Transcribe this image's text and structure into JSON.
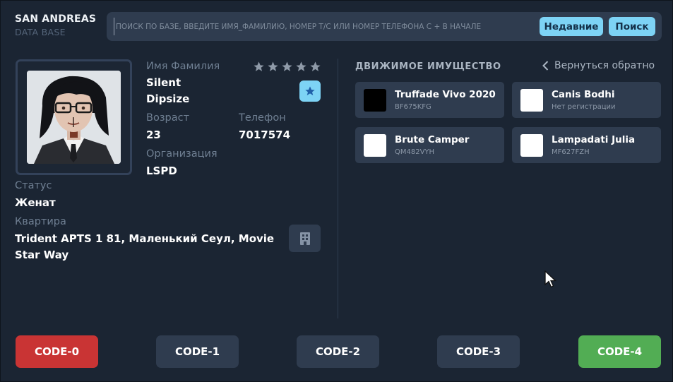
{
  "header": {
    "brand_title": "SAN ANDREAS",
    "brand_subtitle": "DATA BASE",
    "search_placeholder": "ПОИСК ПО БАЗЕ, ВВЕДИТЕ ИМЯ_ФАМИЛИЮ, НОМЕР Т/С ИЛИ НОМЕР ТЕЛЕФОНА С + В НАЧАЛЕ",
    "search_value": "",
    "recent_label": "Недавние",
    "search_label": "Поиск"
  },
  "profile": {
    "name_label": "Имя Фамилия",
    "first_name": "Silent",
    "last_name": "Dipsize",
    "rating": 0,
    "rating_max": 5,
    "age_label": "Возраст",
    "age": "23",
    "phone_label": "Телефон",
    "phone": "7017574",
    "org_label": "Организация",
    "org": "LSPD",
    "status_label": "Статус",
    "status": "Женат",
    "apartment_label": "Квартира",
    "apartment": "Trident APTS 1 81, Маленький Сеул, Movie Star Way"
  },
  "vehicles_section": {
    "title": "ДВИЖИМОЕ ИМУЩЕСТВО",
    "back_label": "Вернуться обратно",
    "items": [
      {
        "name": "Truffade Vivo 2020",
        "plate": "BF675KFG",
        "color": "#000000"
      },
      {
        "name": "Canis Bodhi",
        "plate": "Нет регистрации",
        "color": "#ffffff"
      },
      {
        "name": "Brute Camper",
        "plate": "QM482VYH",
        "color": "#ffffff"
      },
      {
        "name": "Lampadati Julia",
        "plate": "MF627FZH",
        "color": "#ffffff"
      }
    ]
  },
  "codes": [
    {
      "label": "CODE-0",
      "color": "#c93434"
    },
    {
      "label": "CODE-1",
      "color": "#2f3c4f"
    },
    {
      "label": "CODE-2",
      "color": "#2f3c4f"
    },
    {
      "label": "CODE-3",
      "color": "#2f3c4f"
    },
    {
      "label": "CODE-4",
      "color": "#52ad54"
    }
  ],
  "colors": {
    "background": "#1b2533",
    "panel": "#2f3c4f",
    "accent": "#7dd3f5",
    "star_inactive": "#8f9aa8",
    "muted_text": "#6f7f92"
  }
}
